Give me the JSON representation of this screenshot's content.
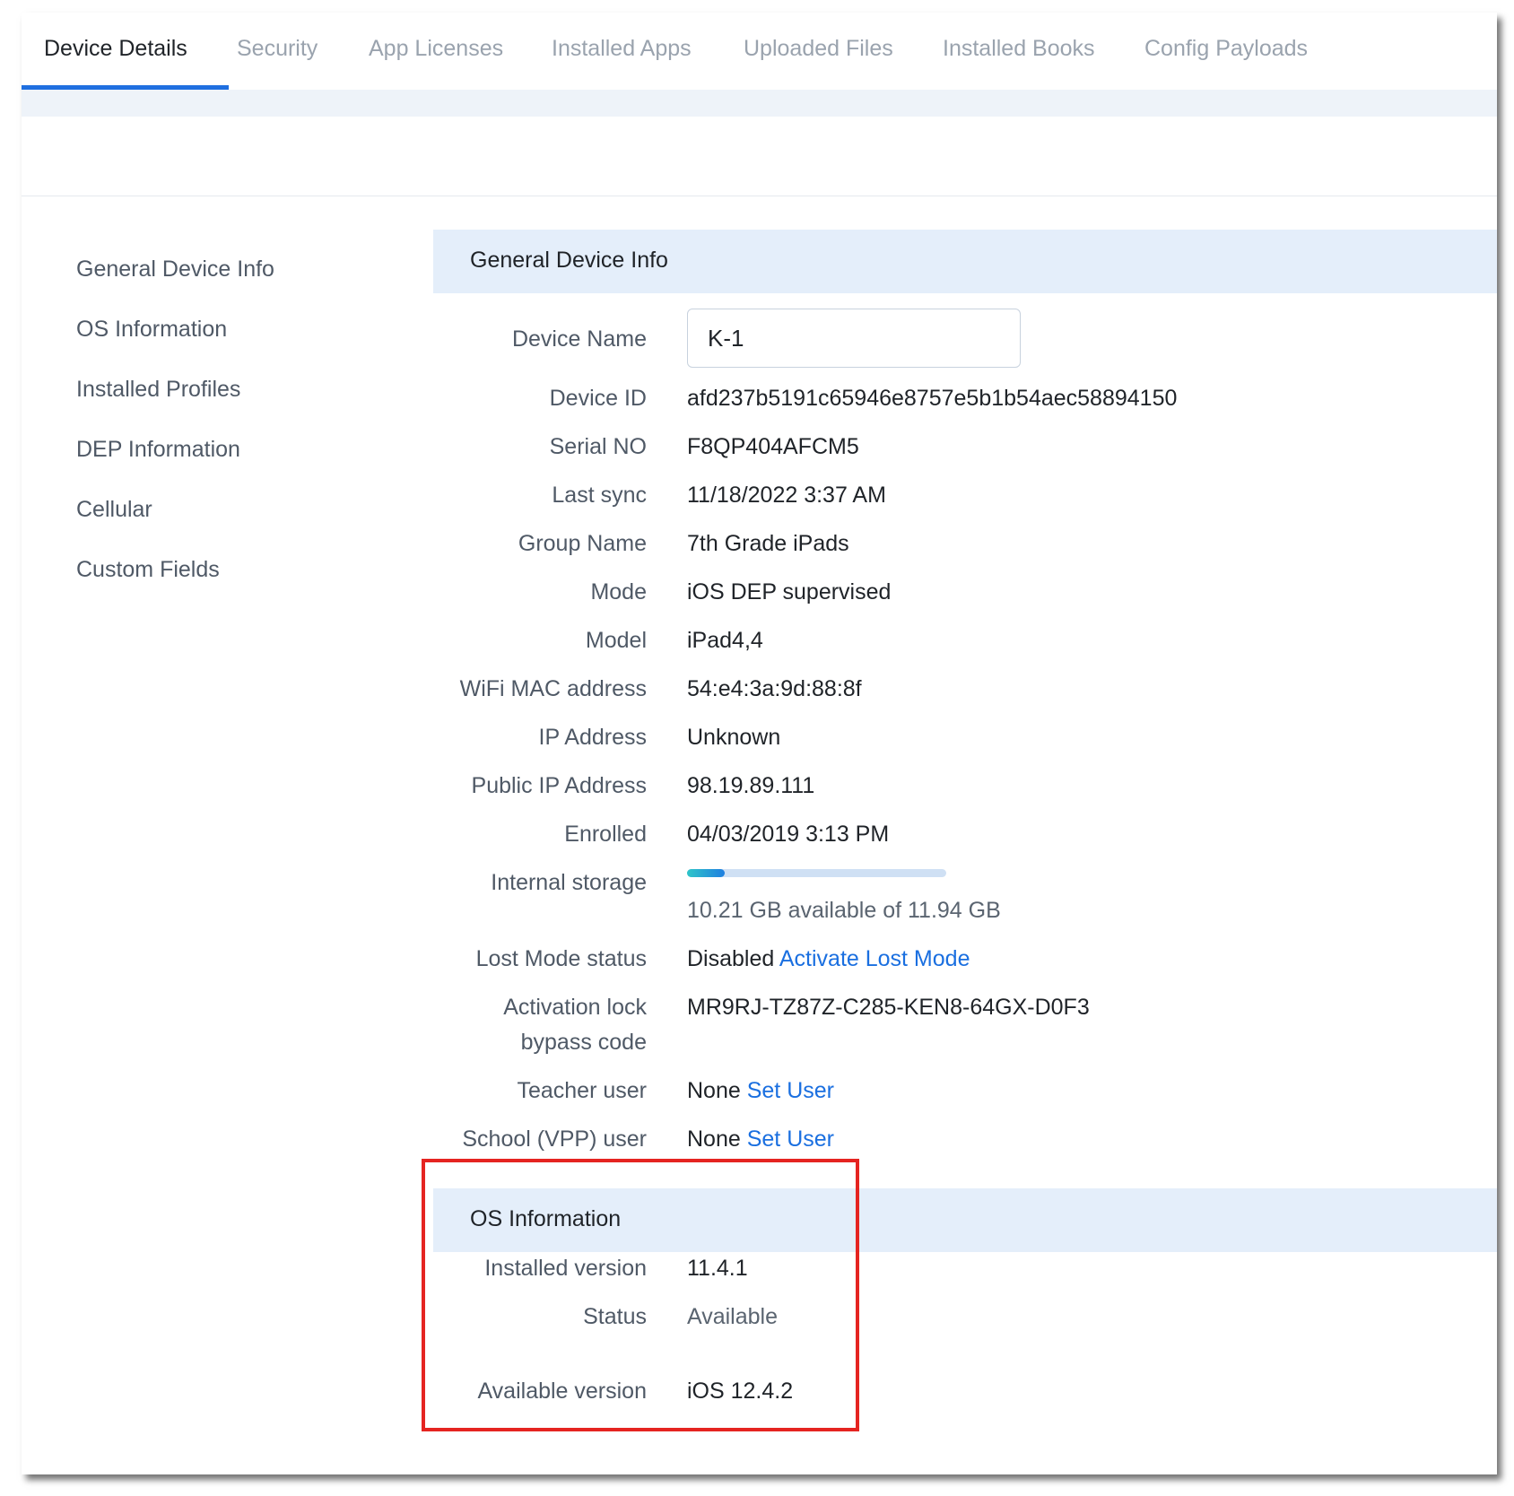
{
  "tabs": [
    "Device Details",
    "Security",
    "App Licenses",
    "Installed Apps",
    "Uploaded Files",
    "Installed Books",
    "Config Payloads"
  ],
  "sidebar": [
    "General Device Info",
    "OS Information",
    "Installed Profiles",
    "DEP Information",
    "Cellular",
    "Custom Fields"
  ],
  "general": {
    "title": "General Device Info",
    "device_name_label": "Device Name",
    "device_name_value": "K-1",
    "device_id_label": "Device ID",
    "device_id": "afd237b5191c65946e8757e5b1b54aec58894150",
    "serial_label": "Serial NO",
    "serial": "F8QP404AFCM5",
    "last_sync_label": "Last sync",
    "last_sync": "11/18/2022 3:37 AM",
    "group_label": "Group Name",
    "group": "7th Grade iPads",
    "mode_label": "Mode",
    "mode": "iOS DEP supervised",
    "model_label": "Model",
    "model": "iPad4,4",
    "wifi_label": "WiFi MAC address",
    "wifi": "54:e4:3a:9d:88:8f",
    "ip_label": "IP Address",
    "ip": "Unknown",
    "public_ip_label": "Public IP Address",
    "public_ip": "98.19.89.111",
    "enrolled_label": "Enrolled",
    "enrolled": "04/03/2019 3:13 PM",
    "storage_label": "Internal storage",
    "storage_text": "10.21 GB available of 11.94 GB",
    "storage_used_fraction": 0.145,
    "lost_mode_label": "Lost Mode status",
    "lost_mode_status": "Disabled",
    "lost_mode_link": "Activate Lost Mode",
    "activation_label_1": "Activation lock",
    "activation_label_2": "bypass code",
    "activation_code": "MR9RJ-TZ87Z-C285-KEN8-64GX-D0F3",
    "teacher_label": "Teacher user",
    "teacher_value": "None",
    "teacher_link": "Set User",
    "school_label": "School (VPP) user",
    "school_value": "None",
    "school_link": "Set User"
  },
  "os": {
    "title": "OS Information",
    "installed_label": "Installed version",
    "installed": "11.4.1",
    "status_label": "Status",
    "status": "Available",
    "available_label": "Available version",
    "available": "iOS 12.4.2"
  },
  "colors": {
    "accent": "#1f6fe0",
    "link": "#1a6fe0",
    "highlight": "#e52421",
    "section_bg": "#e4eefa"
  }
}
